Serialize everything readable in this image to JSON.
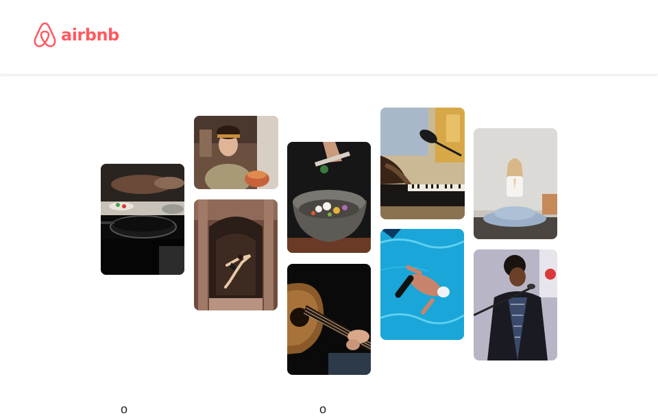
{
  "brand": {
    "name": "airbnb",
    "color": "#ff5a5f"
  },
  "gallery": {
    "tiles": [
      {
        "name": "cooking-class-photo",
        "icon": "photo"
      },
      {
        "name": "chef-portrait-photo",
        "icon": "photo"
      },
      {
        "name": "dancer-archway-photo",
        "icon": "photo"
      },
      {
        "name": "plated-dish-photo",
        "icon": "photo"
      },
      {
        "name": "guitar-player-photo",
        "icon": "photo"
      },
      {
        "name": "microphone-piano-photo",
        "icon": "photo"
      },
      {
        "name": "swimmer-pool-photo",
        "icon": "photo"
      },
      {
        "name": "yoga-meditation-photo",
        "icon": "photo"
      },
      {
        "name": "singer-microphone-photo",
        "icon": "photo"
      }
    ]
  },
  "bottom_glyphs": [
    "o",
    "o"
  ]
}
